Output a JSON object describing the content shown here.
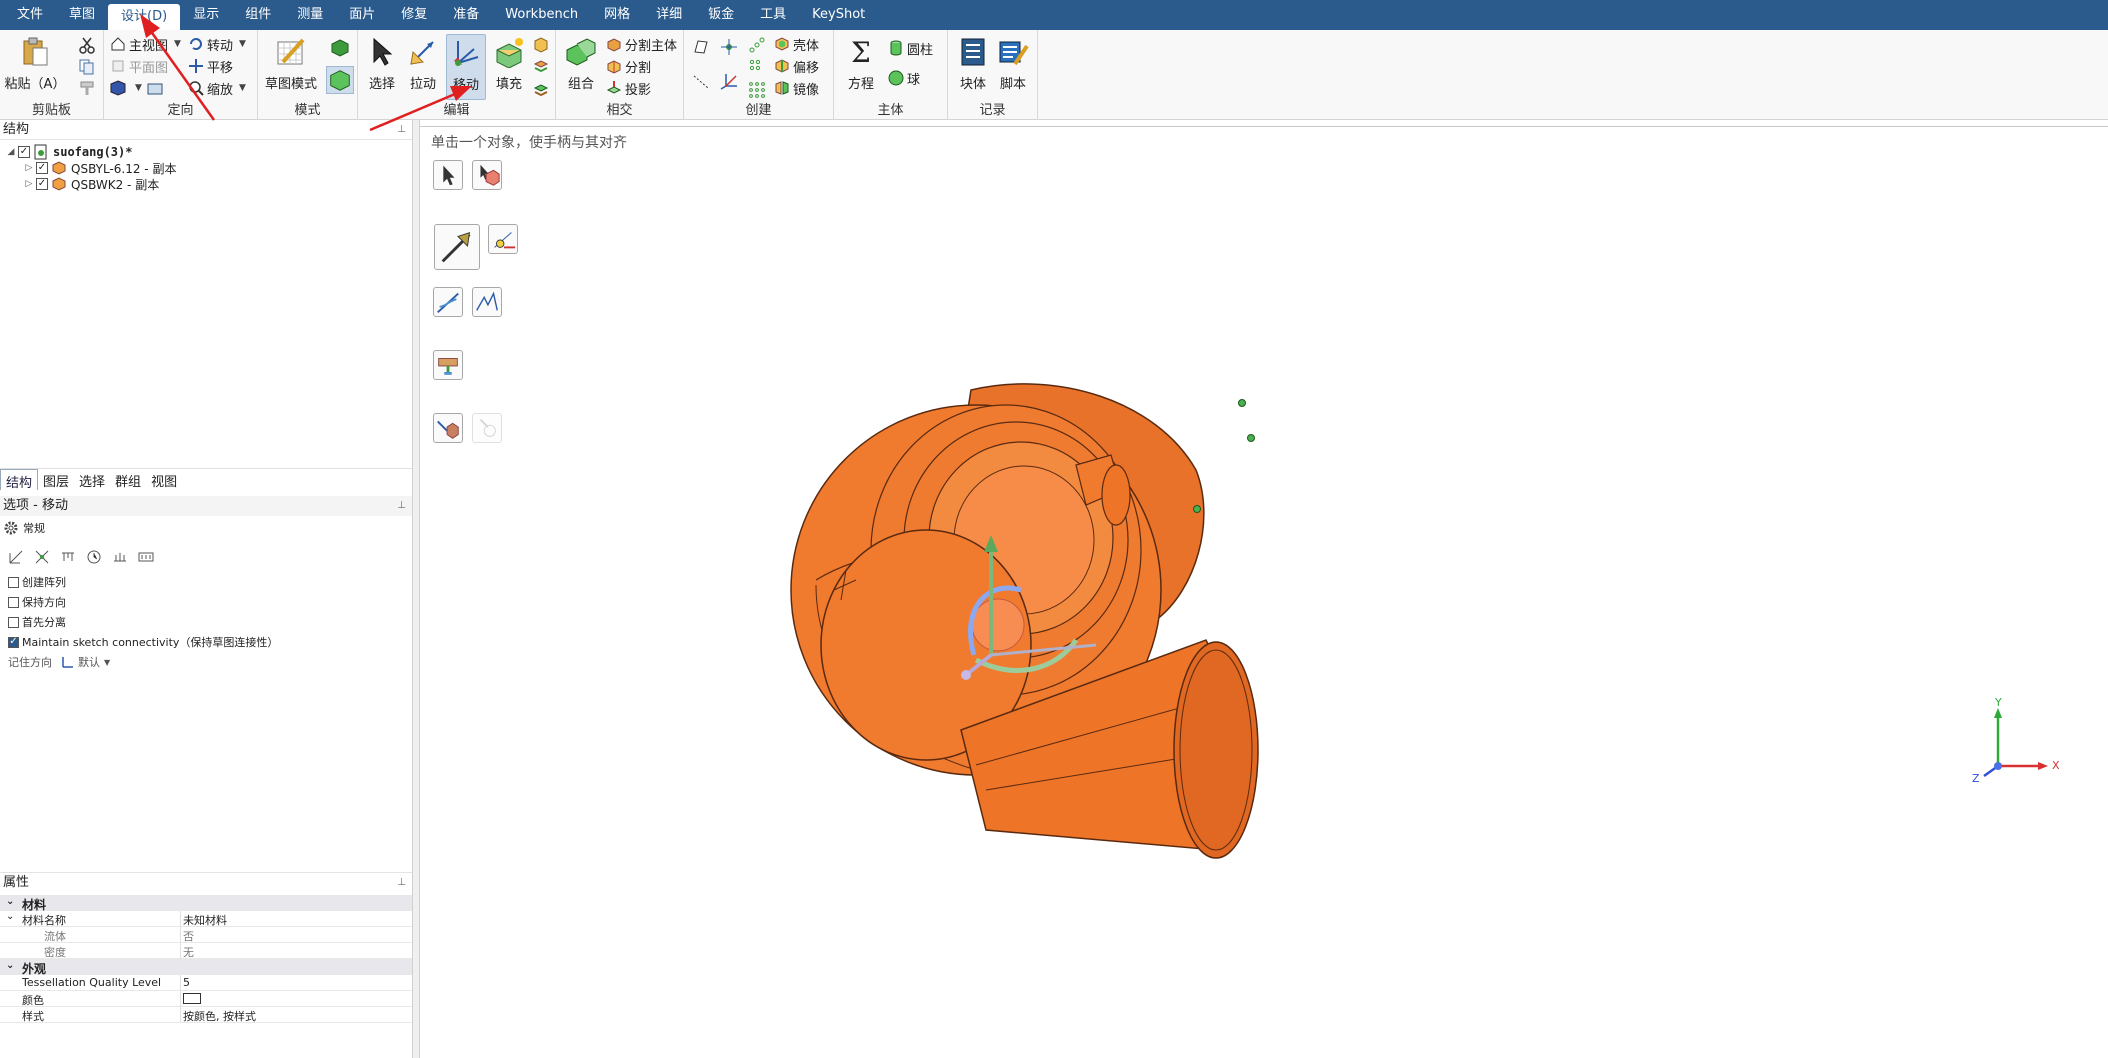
{
  "menu": {
    "tabs": [
      "文件",
      "草图",
      "设计(D)",
      "显示",
      "组件",
      "测量",
      "面片",
      "修复",
      "准备",
      "Workbench",
      "网格",
      "详细",
      "钣金",
      "工具",
      "KeyShot"
    ],
    "active_index": 2
  },
  "ribbon": {
    "clipboard": {
      "paste_label": "粘贴（A）",
      "group_label": "剪贴板"
    },
    "orient": {
      "home_label": "主视图",
      "plane_label": "平面图",
      "rotate_label": "转动",
      "pan_label": "平移",
      "zoom_label": "缩放",
      "group_label": "定向"
    },
    "mode": {
      "sketch_mode_label": "草图模式",
      "group_label": "模式"
    },
    "edit": {
      "select_label": "选择",
      "pull_label": "拉动",
      "move_label": "移动",
      "fill_label": "填充",
      "group_label": "编辑"
    },
    "intersect": {
      "combine_label": "组合",
      "split_body_label": "分割主体",
      "split_label": "分割",
      "project_label": "投影",
      "group_label": "相交"
    },
    "create": {
      "shell_label": "壳体",
      "offset_label": "偏移",
      "mirror_label": "镜像",
      "group_label": "创建"
    },
    "body": {
      "equation_label": "方程",
      "cylinder_label": "圆柱",
      "sphere_label": "球",
      "group_label": "主体"
    },
    "record": {
      "block_label": "块体",
      "script_label": "脚本",
      "group_label": "记录"
    }
  },
  "structure": {
    "header": "结构",
    "root": "suofang(3)*",
    "children": [
      "QSBYL-6.12 - 副本",
      "QSBWK2 - 副本"
    ]
  },
  "panel_tabs": [
    "结构",
    "图层",
    "选择",
    "群组",
    "视图"
  ],
  "options": {
    "header": "选项 - 移动",
    "section": "常规",
    "create_pattern": "创建阵列",
    "keep_orientation": "保持方向",
    "detach_first": "首先分离",
    "maintain_sketch": "Maintain sketch connectivity（保持草图连接性）",
    "remember_dir_label": "记住方向",
    "remember_dir_value": "默认",
    "checks": [
      false,
      false,
      false,
      true
    ]
  },
  "properties": {
    "header": "属性",
    "material_cat": "材料",
    "material_name_label": "材料名称",
    "material_name_value": "未知材料",
    "fluid_label": "流体",
    "fluid_value": "否",
    "density_label": "密度",
    "density_value": "无",
    "appearance_cat": "外观",
    "tess_label": "Tessellation Quality Level",
    "tess_value": "5",
    "color_label": "颜色",
    "style_label": "样式",
    "style_value": "按颜色, 按样式"
  },
  "viewport": {
    "hint": "单击一个对象，使手柄与其对齐",
    "axis_y": "Y",
    "axis_x": "X",
    "axis_z": "Z"
  },
  "colors": {
    "menubar": "#2b5b8c",
    "part_orange": "#f07a2e",
    "arrow_red": "#e02020"
  }
}
